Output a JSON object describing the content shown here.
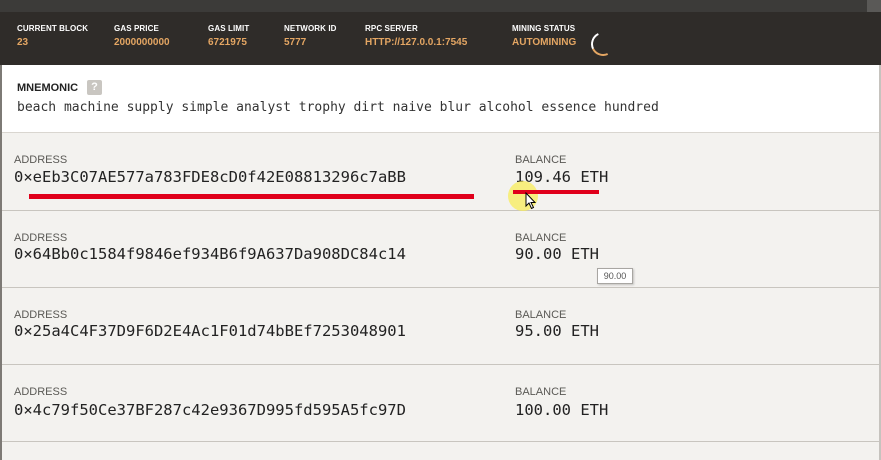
{
  "status": {
    "current_block": {
      "label": "CURRENT BLOCK",
      "value": "23"
    },
    "gas_price": {
      "label": "GAS PRICE",
      "value": "2000000000"
    },
    "gas_limit": {
      "label": "GAS LIMIT",
      "value": "6721975"
    },
    "network_id": {
      "label": "NETWORK ID",
      "value": "5777"
    },
    "rpc_server": {
      "label": "RPC SERVER",
      "value": "HTTP://127.0.0.1:7545"
    },
    "mining_status": {
      "label": "MINING STATUS",
      "value": "AUTOMINING"
    }
  },
  "mnemonic": {
    "title": "MNEMONIC",
    "help_glyph": "?",
    "words": "beach machine supply simple analyst trophy dirt naive blur alcohol essence hundred"
  },
  "accounts": [
    {
      "address_label": "ADDRESS",
      "address": "0×eEb3C07AE577a783FDE8cD0f42E08813296c7aBB",
      "balance_label": "BALANCE",
      "balance": "109.46 ETH"
    },
    {
      "address_label": "ADDRESS",
      "address": "0×64Bb0c1584f9846ef934B6f9A637Da908DC84c14",
      "balance_label": "BALANCE",
      "balance": "90.00 ETH"
    },
    {
      "address_label": "ADDRESS",
      "address": "0×25a4C4F37D9F6D2E4Ac1F01d74bBEf7253048901",
      "balance_label": "BALANCE",
      "balance": "95.00 ETH"
    },
    {
      "address_label": "ADDRESS",
      "address": "0×4c79f50Ce37BF287c42e9367D995fd595A5fc97D",
      "balance_label": "BALANCE",
      "balance": "100.00 ETH"
    }
  ],
  "tooltip": {
    "text": "90.00"
  },
  "colors": {
    "header_bg": "#2f2c29",
    "accent": "#e4a663",
    "annotation_red": "#e0001b",
    "highlight": "#f8ec5a"
  }
}
